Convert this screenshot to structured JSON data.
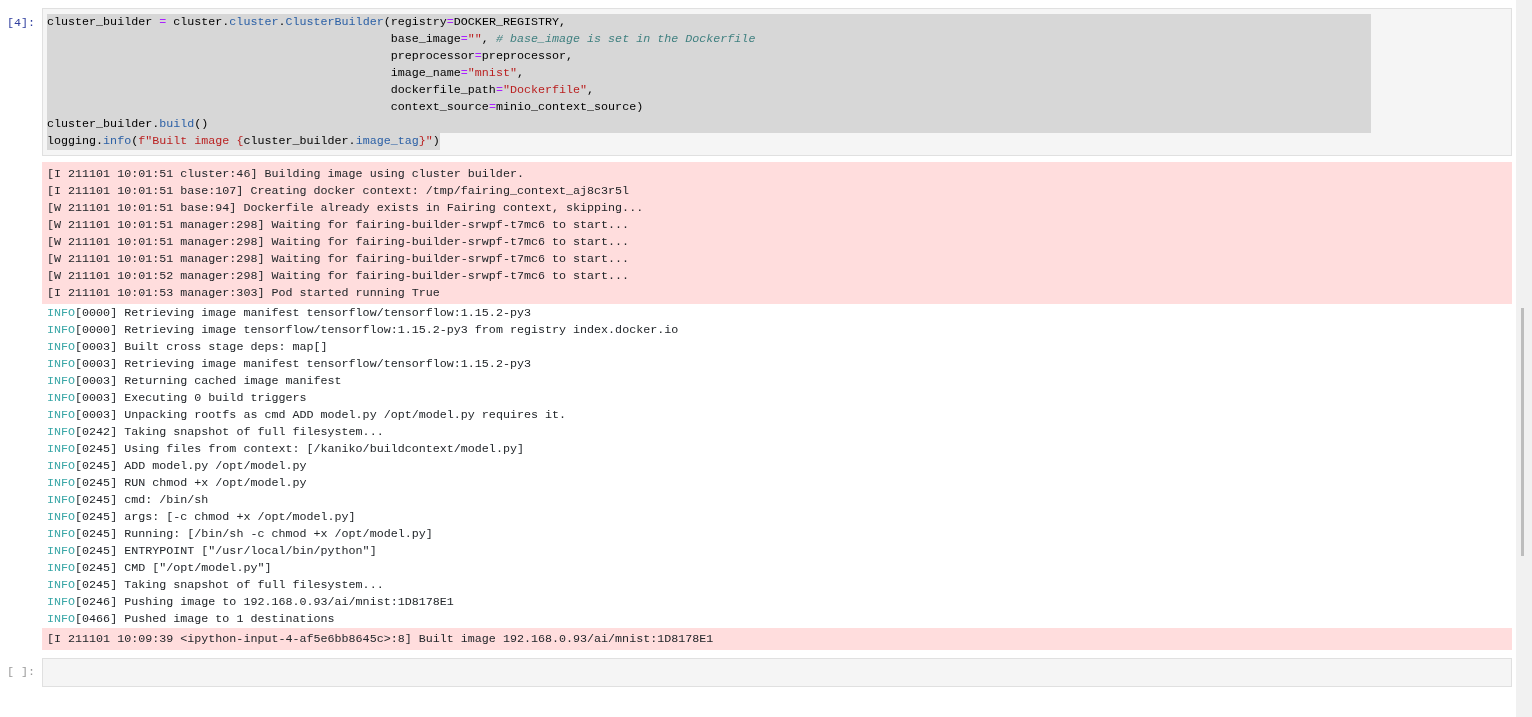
{
  "cells": [
    {
      "prompt": "[4]:",
      "kind": "code",
      "active": true,
      "code_lines": [
        {
          "selected": true,
          "tokens": [
            {
              "kind": "plain",
              "text": "cluster_builder "
            },
            {
              "kind": "op",
              "text": "="
            },
            {
              "kind": "plain",
              "text": " cluster."
            },
            {
              "kind": "attr",
              "text": "cluster"
            },
            {
              "kind": "plain",
              "text": "."
            },
            {
              "kind": "attr",
              "text": "ClusterBuilder"
            },
            {
              "kind": "plain",
              "text": "(registry"
            },
            {
              "kind": "op",
              "text": "="
            },
            {
              "kind": "plain",
              "text": "DOCKER_REGISTRY,"
            }
          ]
        },
        {
          "selected": true,
          "tokens": [
            {
              "kind": "plain",
              "text": "                                                 base_image"
            },
            {
              "kind": "op",
              "text": "="
            },
            {
              "kind": "str",
              "text": "\"\""
            },
            {
              "kind": "plain",
              "text": ", "
            },
            {
              "kind": "comment",
              "text": "# base_image is set in the Dockerfile"
            }
          ]
        },
        {
          "selected": true,
          "tokens": [
            {
              "kind": "plain",
              "text": "                                                 preprocessor"
            },
            {
              "kind": "op",
              "text": "="
            },
            {
              "kind": "plain",
              "text": "preprocessor,"
            }
          ]
        },
        {
          "selected": true,
          "tokens": [
            {
              "kind": "plain",
              "text": "                                                 image_name"
            },
            {
              "kind": "op",
              "text": "="
            },
            {
              "kind": "str",
              "text": "\"mnist\""
            },
            {
              "kind": "plain",
              "text": ","
            }
          ]
        },
        {
          "selected": true,
          "tokens": [
            {
              "kind": "plain",
              "text": "                                                 dockerfile_path"
            },
            {
              "kind": "op",
              "text": "="
            },
            {
              "kind": "str",
              "text": "\"Dockerfile\""
            },
            {
              "kind": "plain",
              "text": ","
            }
          ]
        },
        {
          "selected": true,
          "tokens": [
            {
              "kind": "plain",
              "text": "                                                 context_source"
            },
            {
              "kind": "op",
              "text": "="
            },
            {
              "kind": "plain",
              "text": "minio_context_source)"
            }
          ]
        },
        {
          "selected": true,
          "tokens": [
            {
              "kind": "plain",
              "text": "cluster_builder."
            },
            {
              "kind": "attr",
              "text": "build"
            },
            {
              "kind": "plain",
              "text": "()"
            }
          ]
        },
        {
          "selected": true,
          "tokens": [
            {
              "kind": "plain",
              "text": "logging."
            },
            {
              "kind": "attr",
              "text": "info"
            },
            {
              "kind": "plain",
              "text": "("
            },
            {
              "kind": "str",
              "text": "f\"Built image {"
            },
            {
              "kind": "plain",
              "text": "cluster_builder."
            },
            {
              "kind": "attr",
              "text": "image_tag"
            },
            {
              "kind": "str",
              "text": "}\""
            },
            {
              "kind": "plain",
              "text": ")"
            }
          ]
        }
      ],
      "outputs": [
        {
          "kind": "stderr",
          "lines": [
            {
              "text": "[I 211101 10:01:51 cluster:46] Building image using cluster builder."
            },
            {
              "text": "[I 211101 10:01:51 base:107] Creating docker context: /tmp/fairing_context_aj8c3r5l"
            },
            {
              "text": "[W 211101 10:01:51 base:94] Dockerfile already exists in Fairing context, skipping..."
            },
            {
              "text": "[W 211101 10:01:51 manager:298] Waiting for fairing-builder-srwpf-t7mc6 to start..."
            },
            {
              "text": "[W 211101 10:01:51 manager:298] Waiting for fairing-builder-srwpf-t7mc6 to start..."
            },
            {
              "text": "[W 211101 10:01:51 manager:298] Waiting for fairing-builder-srwpf-t7mc6 to start..."
            },
            {
              "text": "[W 211101 10:01:52 manager:298] Waiting for fairing-builder-srwpf-t7mc6 to start..."
            },
            {
              "text": "[I 211101 10:01:53 manager:303] Pod started running True"
            }
          ]
        },
        {
          "kind": "stdout",
          "lines": [
            {
              "tag": "INFO",
              "text": "[0000] Retrieving image manifest tensorflow/tensorflow:1.15.2-py3"
            },
            {
              "tag": "INFO",
              "text": "[0000] Retrieving image tensorflow/tensorflow:1.15.2-py3 from registry index.docker.io"
            },
            {
              "tag": "INFO",
              "text": "[0003] Built cross stage deps: map[]"
            },
            {
              "tag": "INFO",
              "text": "[0003] Retrieving image manifest tensorflow/tensorflow:1.15.2-py3"
            },
            {
              "tag": "INFO",
              "text": "[0003] Returning cached image manifest"
            },
            {
              "tag": "INFO",
              "text": "[0003] Executing 0 build triggers"
            },
            {
              "tag": "INFO",
              "text": "[0003] Unpacking rootfs as cmd ADD model.py /opt/model.py requires it."
            },
            {
              "tag": "INFO",
              "text": "[0242] Taking snapshot of full filesystem..."
            },
            {
              "tag": "INFO",
              "text": "[0245] Using files from context: [/kaniko/buildcontext/model.py]"
            },
            {
              "tag": "INFO",
              "text": "[0245] ADD model.py /opt/model.py"
            },
            {
              "tag": "INFO",
              "text": "[0245] RUN chmod +x /opt/model.py"
            },
            {
              "tag": "INFO",
              "text": "[0245] cmd: /bin/sh"
            },
            {
              "tag": "INFO",
              "text": "[0245] args: [-c chmod +x /opt/model.py]"
            },
            {
              "tag": "INFO",
              "text": "[0245] Running: [/bin/sh -c chmod +x /opt/model.py]"
            },
            {
              "tag": "INFO",
              "text": "[0245] ENTRYPOINT [\"/usr/local/bin/python\"]"
            },
            {
              "tag": "INFO",
              "text": "[0245] CMD [\"/opt/model.py\"]"
            },
            {
              "tag": "INFO",
              "text": "[0245] Taking snapshot of full filesystem..."
            },
            {
              "tag": "INFO",
              "text": "[0246] Pushing image to 192.168.0.93/ai/mnist:1D8178E1"
            },
            {
              "tag": "INFO",
              "text": "[0466] Pushed image to 1 destinations"
            }
          ]
        },
        {
          "kind": "stderr",
          "lines": [
            {
              "text": "[I 211101 10:09:39 <ipython-input-4-af5e6bb8645c>:8] Built image 192.168.0.93/ai/mnist:1D8178E1"
            }
          ]
        }
      ]
    },
    {
      "prompt": "[ ]:",
      "kind": "code",
      "active": false
    }
  ]
}
